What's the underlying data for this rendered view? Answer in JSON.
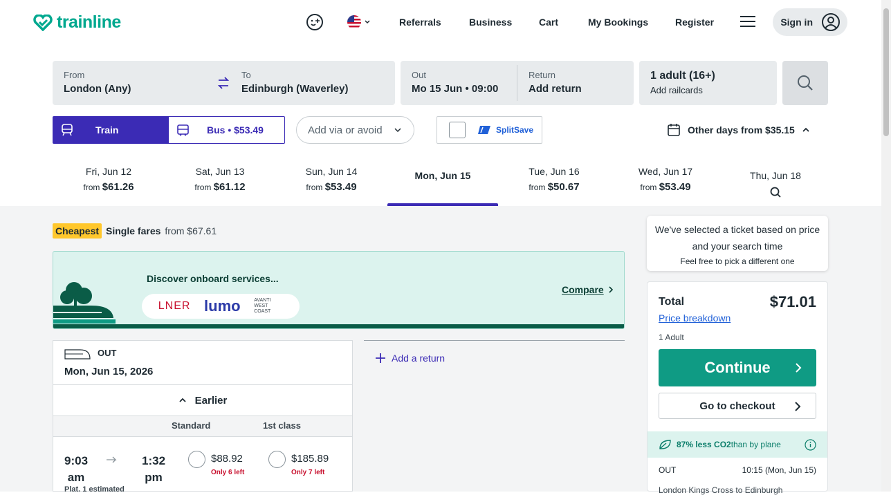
{
  "header": {
    "logo_text": "trainline",
    "nav": [
      "Referrals",
      "Business",
      "Cart",
      "My Bookings",
      "Register"
    ],
    "sign_in": "Sign in",
    "icons": [
      "smiley-plus-icon",
      "us-flag-icon",
      "hamburger-menu-icon",
      "user-icon"
    ]
  },
  "search": {
    "from_label": "From",
    "from_value": "London (Any)",
    "to_label": "To",
    "to_value": "Edinburgh (Waverley)",
    "out_label": "Out",
    "out_value": "Mo 15 Jun • 09:00",
    "return_label": "Return",
    "return_value": "Add return",
    "passengers": "1 adult (16+)",
    "railcards": "Add railcards"
  },
  "mode": {
    "train": "Train",
    "bus": "Bus • $53.49",
    "via_placeholder": "Add via or avoid",
    "splitsave": "SplitSave",
    "other_days": "Other days from $35.15"
  },
  "dates": [
    {
      "day": "Fri, Jun 12",
      "from": "from",
      "price": "$61.26"
    },
    {
      "day": "Sat, Jun 13",
      "from": "from",
      "price": "$61.12"
    },
    {
      "day": "Sun, Jun 14",
      "from": "from",
      "price": "$53.49"
    },
    {
      "day": "Mon, Jun 15",
      "from": "",
      "price": ""
    },
    {
      "day": "Tue, Jun 16",
      "from": "from",
      "price": "$50.67"
    },
    {
      "day": "Wed, Jun 17",
      "from": "from",
      "price": "$53.49"
    },
    {
      "day": "Thu, Jun 18",
      "from": "",
      "price": ""
    }
  ],
  "fares": {
    "badge": "Cheapest",
    "label": "Single fares",
    "from_text": "from $67.61"
  },
  "promo": {
    "title": "Discover onboard services...",
    "compare": "Compare",
    "brands": [
      "LNER",
      "lumo",
      "AVANTI WEST COAST"
    ]
  },
  "outbound": {
    "label": "OUT",
    "date": "Mon, Jun 15, 2026",
    "earlier": "Earlier",
    "col_standard": "Standard",
    "col_first": "1st class",
    "row": {
      "dep": "9:03",
      "dep_ampm": "am",
      "arr": "1:32",
      "arr_ampm": "pm",
      "std_price": "$88.92",
      "std_left": "Only 6 left",
      "first_price": "$185.89",
      "first_left": "Only 7 left",
      "platform": "Plat. 1 estimated"
    }
  },
  "return": {
    "add": "Add a return"
  },
  "tip": {
    "line1": "We've selected a ticket based on price",
    "line2": "and your search time",
    "line3": "Feel free to pick a different one"
  },
  "summary": {
    "total_label": "Total",
    "total_value": "$71.01",
    "breakdown": "Price breakdown",
    "passengers": "1 Adult",
    "continue": "Continue",
    "checkout": "Go to checkout",
    "co2_bold": "87% less CO2",
    "co2_rest": " than by plane",
    "out_label": "OUT",
    "out_time": "10:15 (Mon, Jun 15)",
    "route": "London Kings Cross to Edinburgh"
  },
  "colors": {
    "brand": "#00a88f",
    "accent": "#3b2bb5",
    "warn": "#c8102e",
    "badge": "#ffc72c"
  }
}
